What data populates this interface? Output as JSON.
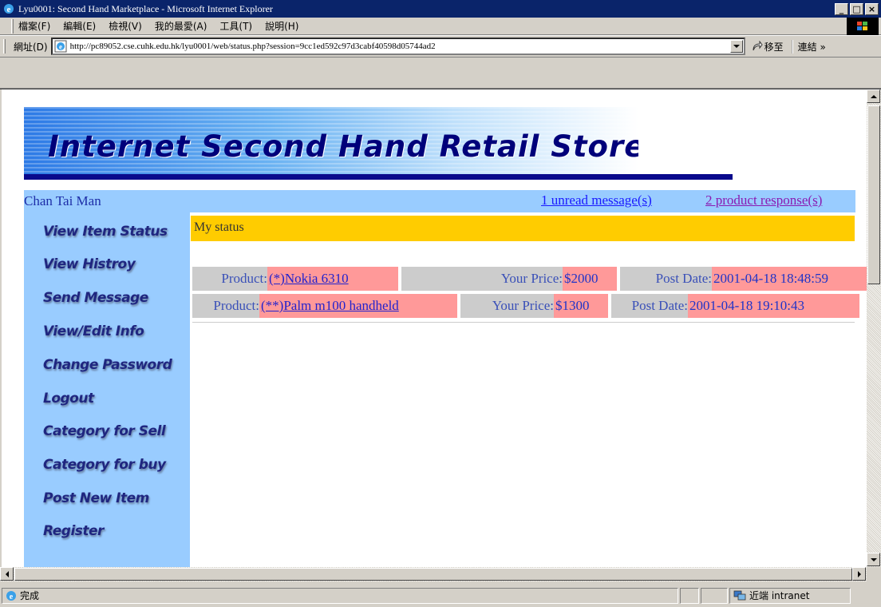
{
  "window": {
    "title": "Lyu0001: Second Hand Marketplace - Microsoft Internet Explorer",
    "minimize": "_",
    "maximize": "□",
    "close": "×"
  },
  "menu": {
    "items": [
      "檔案(F)",
      "編輯(E)",
      "檢視(V)",
      "我的最愛(A)",
      "工具(T)",
      "說明(H)"
    ]
  },
  "address": {
    "label": "網址(D)",
    "url": "http://pc89052.cse.cuhk.edu.hk/lyu0001/web/status.php?session=9cc1ed592c97d3cabf40598d05744ad2",
    "go_label": "移至",
    "links_label": "連結 »"
  },
  "page": {
    "banner_title": "Internet Second Hand Retail Store",
    "user_name": "Chan Tai Man",
    "unread_link": "1 unread message(s)",
    "response_link": "2 product response(s)",
    "status_heading": "My status",
    "nav": [
      "View Item Status",
      "View Histroy",
      "Send Message",
      "View/Edit Info",
      "Change Password",
      "Logout",
      "Category for Sell",
      "Category for buy",
      "Post New Item",
      "Register"
    ],
    "items": [
      {
        "product_label": "Product:",
        "product": "(*)Nokia 6310",
        "price_label": "Your Price:",
        "price": "$2000",
        "date_label": "Post Date:",
        "date": "2001-04-18 18:48:59"
      },
      {
        "product_label": "Product:",
        "product": "(**)Palm m100 handheld",
        "price_label": "Your Price:",
        "price": "$1300",
        "date_label": "Post Date:",
        "date": "2001-04-18 19:10:43"
      }
    ]
  },
  "statusbar": {
    "text": "完成",
    "zone": "近端 intranet"
  },
  "colors": {
    "sidebar_bg": "#99ccff",
    "status_heading_bg": "#ffcc00",
    "value_cell_bg": "#ff9999",
    "label_cell_bg": "#cccccc",
    "titlebar_bg": "#0a246a"
  }
}
